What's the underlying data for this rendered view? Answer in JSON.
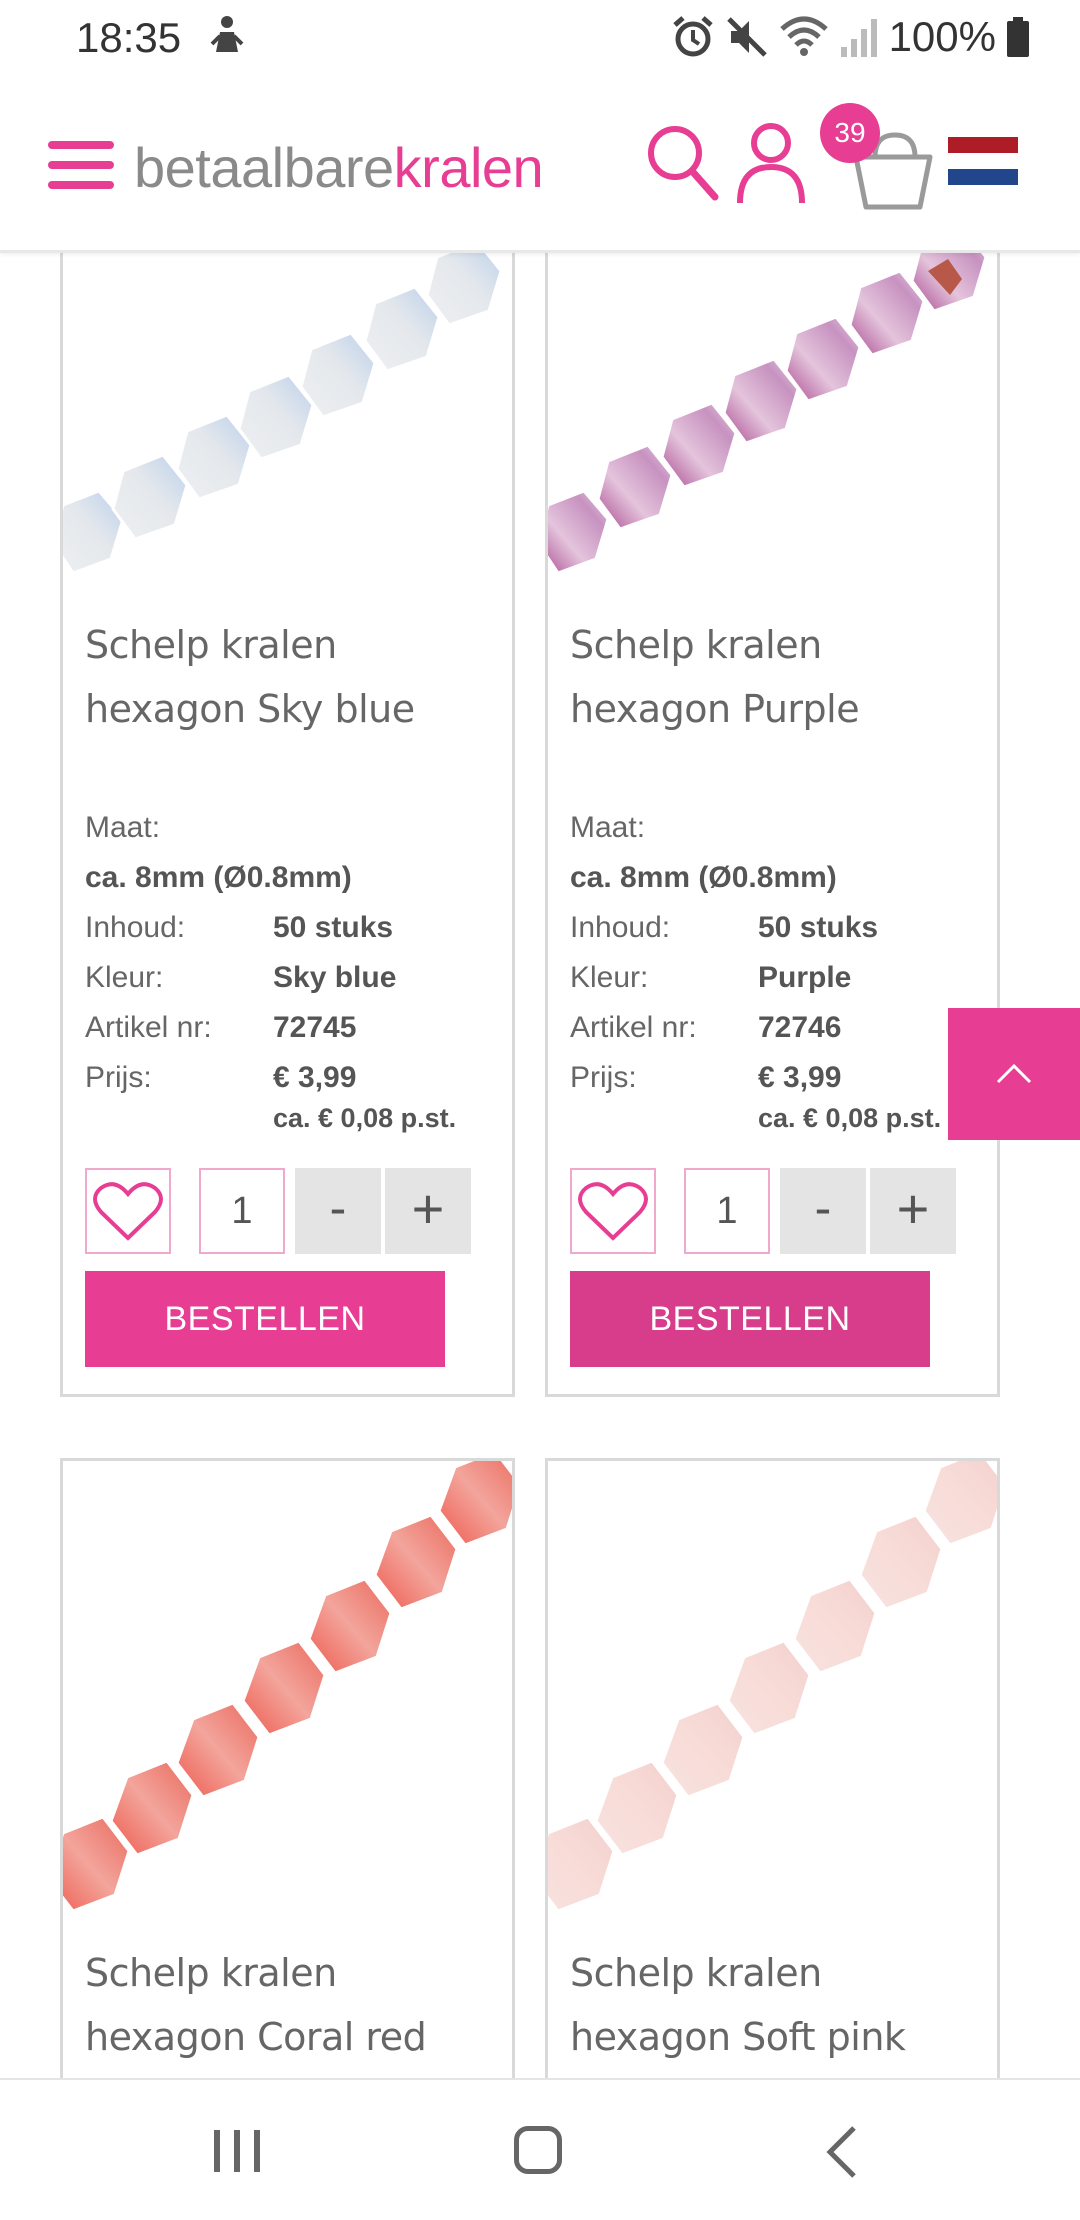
{
  "status_bar": {
    "time": "18:35",
    "battery_text": "100%",
    "icons": [
      "person-notification-icon",
      "alarm-icon",
      "mute-icon",
      "wifi-icon",
      "signal-icon",
      "battery-icon"
    ]
  },
  "header": {
    "logo_part1": "betaalbare",
    "logo_part2": "kralen",
    "cart_count": "39",
    "brand_color": "#e73e94"
  },
  "labels": {
    "size": "Maat:",
    "content": "Inhoud:",
    "color": "Kleur:",
    "article": "Artikel nr:",
    "price": "Prijs:",
    "order": "BESTELLEN",
    "minus": "-",
    "plus": "+"
  },
  "products": [
    {
      "title_line1": "Schelp kralen",
      "title_line2": "hexagon Sky blue",
      "size": "ca. 8mm (Ø0.8mm)",
      "content": "50 stuks",
      "color": "Sky blue",
      "article": "72745",
      "price": "€ 3,99",
      "unit_price": "ca. € 0,08 p.st.",
      "quantity": "1"
    },
    {
      "title_line1": "Schelp kralen",
      "title_line2": "hexagon Purple",
      "size": "ca. 8mm (Ø0.8mm)",
      "content": "50 stuks",
      "color": "Purple",
      "article": "72746",
      "price": "€ 3,99",
      "unit_price": "ca. € 0,08 p.st.",
      "quantity": "1"
    },
    {
      "title_line1": "Schelp kralen",
      "title_line2": "hexagon Coral red"
    },
    {
      "title_line1": "Schelp kralen",
      "title_line2": "hexagon Soft pink"
    }
  ]
}
